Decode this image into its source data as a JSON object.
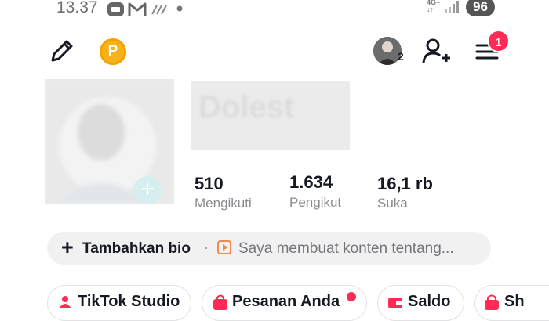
{
  "status_bar": {
    "time": "13.37",
    "network": "4G+",
    "battery": "96",
    "icons": [
      "message-icon",
      "gmail-icon",
      "signal-icon",
      "dot-icon"
    ]
  },
  "header": {
    "coin_label": "P",
    "avatar_count": "2",
    "notification_count": "1"
  },
  "profile": {
    "name": "Dolest"
  },
  "stats": [
    {
      "value": "510",
      "label": "Mengikuti"
    },
    {
      "value": "1.634",
      "label": "Pengikut"
    },
    {
      "value": "16,1 rb",
      "label": "Suka"
    }
  ],
  "bio": {
    "add_label": "Tambahkan bio",
    "separator": "·",
    "description": "Saya membuat konten tentang..."
  },
  "shortcuts": [
    {
      "label": "TikTok Studio",
      "icon": "tiktok-studio-icon"
    },
    {
      "label": "Pesanan Anda",
      "icon": "shopping-bag-icon"
    },
    {
      "label": "Saldo",
      "icon": "wallet-icon"
    },
    {
      "label": "Sh",
      "icon": "shop-icon"
    }
  ],
  "colors": {
    "accent": "#fe2c55",
    "coin": "#f5b21a",
    "bio_play": "#f08a52",
    "muted_text": "#8a8b91"
  }
}
